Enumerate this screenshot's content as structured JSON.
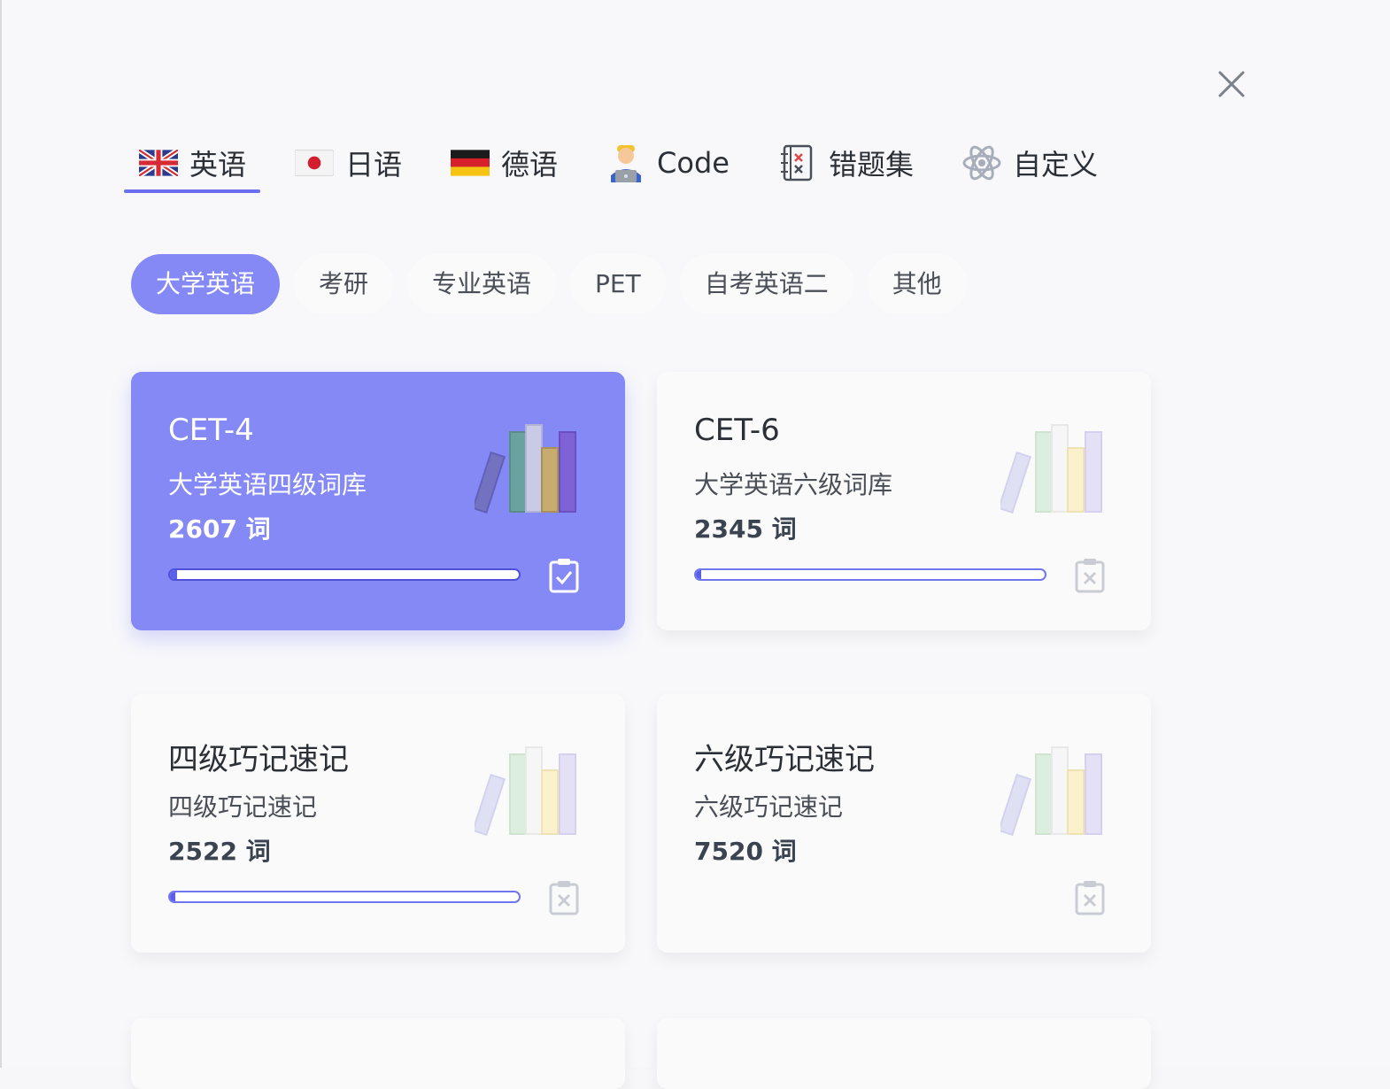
{
  "language_tabs": [
    {
      "label": "英语",
      "icon": "uk-flag-icon",
      "active": true
    },
    {
      "label": "日语",
      "icon": "japan-flag-icon",
      "active": false
    },
    {
      "label": "德语",
      "icon": "germany-flag-icon",
      "active": false
    },
    {
      "label": "Code",
      "icon": "coder-icon",
      "active": false
    },
    {
      "label": "错题集",
      "icon": "mistake-book-icon",
      "active": false
    },
    {
      "label": "自定义",
      "icon": "atom-icon",
      "active": false
    }
  ],
  "categories": [
    {
      "label": "大学英语",
      "active": true
    },
    {
      "label": "考研",
      "active": false
    },
    {
      "label": "专业英语",
      "active": false
    },
    {
      "label": "PET",
      "active": false
    },
    {
      "label": "自考英语二",
      "active": false
    },
    {
      "label": "其他",
      "active": false
    }
  ],
  "cards": [
    {
      "name": "CET-4",
      "desc": "大学英语四级词库",
      "count": "2607 词",
      "selected": true,
      "progress": 0.02,
      "has_progress": true,
      "clip_icon": "clipboard-check-icon"
    },
    {
      "name": "CET-6",
      "desc": "大学英语六级词库",
      "count": "2345 词",
      "selected": false,
      "progress": 0.01,
      "has_progress": true,
      "clip_icon": "clipboard-x-icon"
    },
    {
      "name": "四级巧记速记",
      "desc": "四级巧记速记",
      "count": "2522 词",
      "selected": false,
      "progress": 0.01,
      "has_progress": true,
      "clip_icon": "clipboard-x-icon"
    },
    {
      "name": "六级巧记速记",
      "desc": "六级巧记速记",
      "count": "7520 词",
      "selected": false,
      "progress": 0,
      "has_progress": false,
      "clip_icon": "clipboard-x-icon"
    }
  ],
  "colors": {
    "accent": "#8489f6",
    "accent_dark": "#6c6ef0",
    "card_bg": "#fafafa",
    "page_bg": "#f8f8fb"
  }
}
